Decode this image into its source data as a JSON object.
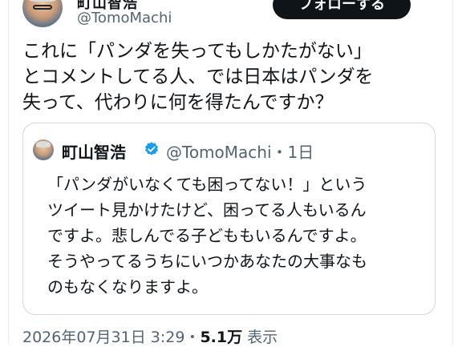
{
  "author": {
    "name_partial": "町山智浩",
    "handle": "@TomoMachi"
  },
  "follow_button_label": "フォローする",
  "tweet": {
    "lines": [
      "これに「パンダを失ってもしかたがない」",
      "とコメントしてる人、では日本はパンダを",
      "失って、代わりに何を得たんですか？"
    ]
  },
  "quoted_tweet": {
    "author_name": "町山智浩",
    "handle": "@TomoMachi",
    "separator": "・",
    "age": "1日",
    "lines": [
      "「パンダがいなくても困ってない！」という",
      "ツイート見かけたけど、困ってる人もいるん",
      "ですよ。悲しんでる子どももいるんですよ。",
      "そうやってるうちにいつかあなたの大事なも",
      "のもなくなりますよ。"
    ]
  },
  "footer": {
    "timestamp": "2026年07月31日 3:29",
    "separator": "・",
    "view_count": "5.1万",
    "view_label": "表示"
  },
  "colors": {
    "text": "#0f1419",
    "secondary": "#536471",
    "verified_badge": "#1d9bf0",
    "border": "#cfd9de"
  }
}
